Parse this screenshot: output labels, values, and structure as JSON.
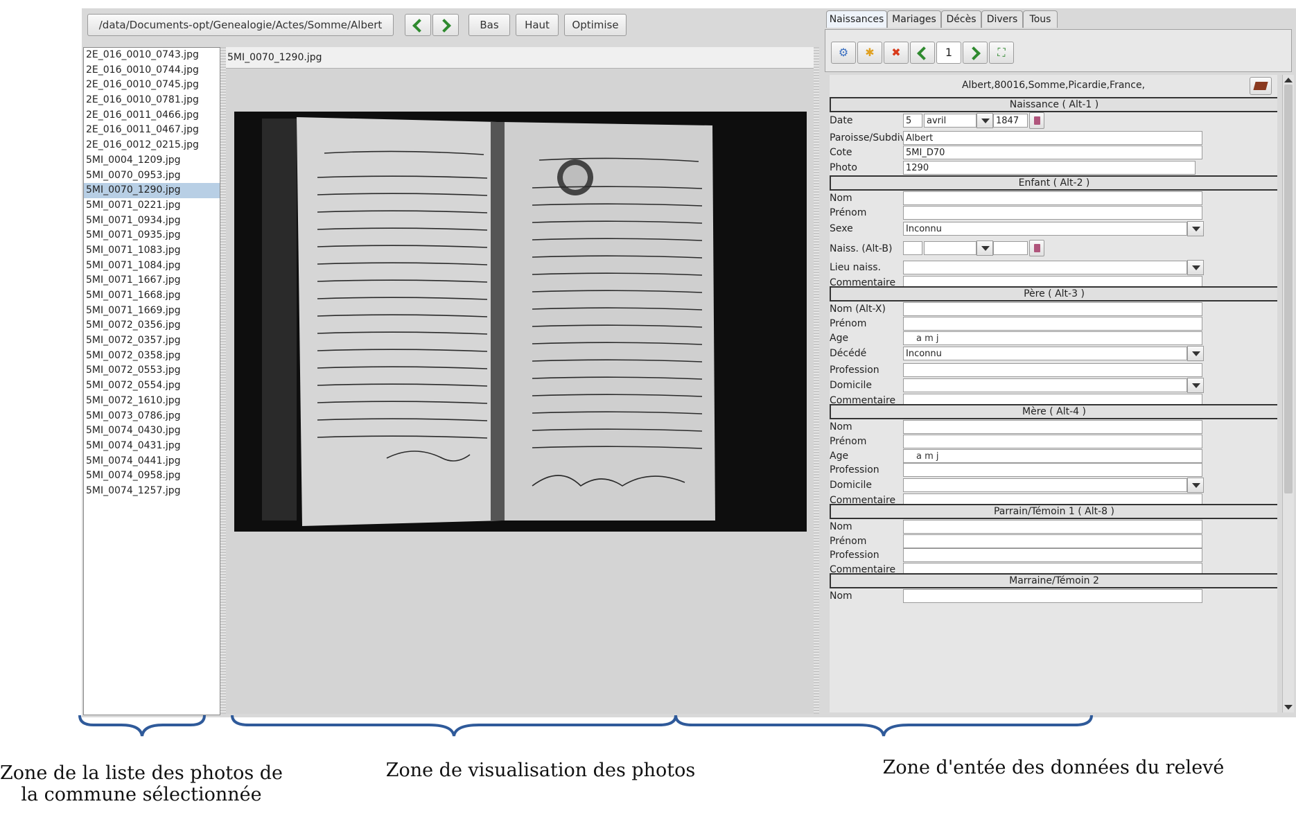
{
  "toolbar": {
    "path": "/data/Documents-opt/Genealogie/Actes/Somme/Albert",
    "bas_label": "Bas",
    "haut_label": "Haut",
    "optimise_label": "Optimise"
  },
  "files": [
    "2E_016_0010_0743.jpg",
    "2E_016_0010_0744.jpg",
    "2E_016_0010_0745.jpg",
    "2E_016_0010_0781.jpg",
    "2E_016_0011_0466.jpg",
    "2E_016_0011_0467.jpg",
    "2E_016_0012_0215.jpg",
    "5MI_0004_1209.jpg",
    "5MI_0070_0953.jpg",
    "5MI_0070_1290.jpg",
    "5MI_0071_0221.jpg",
    "5MI_0071_0934.jpg",
    "5MI_0071_0935.jpg",
    "5MI_0071_1083.jpg",
    "5MI_0071_1084.jpg",
    "5MI_0071_1667.jpg",
    "5MI_0071_1668.jpg",
    "5MI_0071_1669.jpg",
    "5MI_0072_0356.jpg",
    "5MI_0072_0357.jpg",
    "5MI_0072_0358.jpg",
    "5MI_0072_0553.jpg",
    "5MI_0072_0554.jpg",
    "5MI_0072_1610.jpg",
    "5MI_0073_0786.jpg",
    "5MI_0074_0430.jpg",
    "5MI_0074_0431.jpg",
    "5MI_0074_0441.jpg",
    "5MI_0074_0958.jpg",
    "5MI_0074_1257.jpg"
  ],
  "viewer": {
    "filename": "5MI_0070_1290.jpg"
  },
  "tabs": [
    "Naissances",
    "Mariages",
    "Décès",
    "Divers",
    "Tous"
  ],
  "iconbar": {
    "page": "1"
  },
  "form": {
    "place": "Albert,80016,Somme,Picardie,France,",
    "naissance_header": "Naissance   ( Alt-1 )",
    "date_label": "Date",
    "date_day": "5",
    "date_month": "avril",
    "date_year": "1847",
    "paroisse_label": "Paroisse/Subdiv.",
    "paroisse_value": "Albert",
    "cote_label": "Cote",
    "cote_value": "5MI_D70",
    "photo_label": "Photo",
    "photo_value": "1290",
    "enfant_header": "Enfant   ( Alt-2 )",
    "nom_label": "Nom",
    "prenom_label": "Prénom",
    "sexe_label": "Sexe",
    "sexe_value": "Inconnu",
    "naiss_label": "Naiss. (Alt-B)",
    "lieu_label": "Lieu naiss.",
    "commentaire_label": "Commentaire",
    "pere_header": "Père   ( Alt-3 )",
    "nom_altx_label": "Nom (Alt-X)",
    "age_label": "Age",
    "age_value": "a    m    j",
    "decede_label": "Décédé",
    "decede_value": "Inconnu",
    "profession_label": "Profession",
    "domicile_label": "Domicile",
    "mere_header": "Mère   ( Alt-4 )",
    "parrain_header": "Parrain/Témoin 1   ( Alt-8 )",
    "marraine_header": "Marraine/Témoin 2"
  },
  "captions": {
    "left": "Zone de la liste des photos de la commune sélectionnée",
    "middle": "Zone de visualisation des photos",
    "right": "Zone d'entée des données du relevé"
  }
}
